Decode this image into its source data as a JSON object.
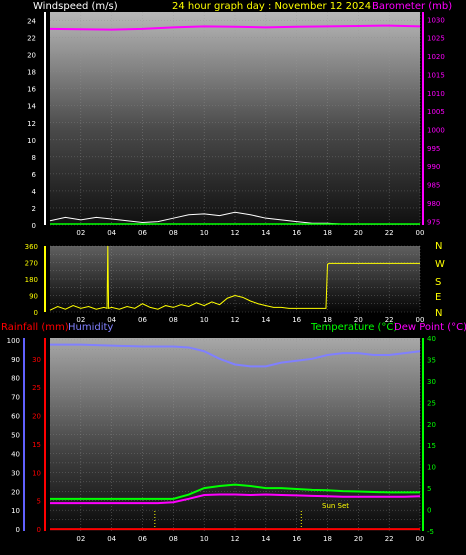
{
  "header": {
    "left_label": "Windspeed (m/s)",
    "title": "24 hour graph day : November 12 2024",
    "right_label": "Barometer (mb)"
  },
  "direction_labels": [
    "N",
    "W",
    "S",
    "E",
    "N"
  ],
  "lower_header": {
    "rain_label": "Rainfall (mm)",
    "hum_label": "Humidity",
    "temp_label": "Temperature (°C)",
    "dew_label": "Dew Point (°C)"
  },
  "sunset_label": "Sun Set",
  "colors": {
    "windspeed": "#ffffff",
    "gust": "#00ff00",
    "barometer": "#ff00ff",
    "direction": "#ffff00",
    "temperature": "#00ff00",
    "dewpoint": "#ff00ff",
    "humidity": "#8080ff",
    "rainfall": "#ff0000",
    "title": "#ffff00"
  },
  "chart_data": [
    {
      "type": "line",
      "x_ticks": [
        "02",
        "04",
        "06",
        "08",
        "10",
        "12",
        "14",
        "16",
        "18",
        "20",
        "22",
        "00"
      ],
      "left_axis": {
        "label": "Windspeed (m/s)",
        "ticks": [
          0,
          2,
          4,
          6,
          8,
          10,
          12,
          14,
          16,
          18,
          20,
          22,
          24
        ],
        "range": [
          0,
          25
        ]
      },
      "right_axis": {
        "label": "Barometer (mb)",
        "ticks": [
          975,
          980,
          985,
          990,
          995,
          1000,
          1005,
          1010,
          1015,
          1020,
          1025,
          1030
        ],
        "range": [
          974,
          1032
        ]
      },
      "series": [
        {
          "name": "Barometer (mb)",
          "x": [
            0,
            2,
            4,
            6,
            8,
            10,
            12,
            14,
            16,
            18,
            20,
            22,
            24
          ],
          "values": [
            1027.4,
            1027.3,
            1027.2,
            1027.4,
            1027.8,
            1028.1,
            1028.0,
            1027.8,
            1028.0,
            1028.1,
            1028.2,
            1028.3,
            1028.1
          ]
        },
        {
          "name": "Windspeed (m/s)",
          "x": [
            0,
            1,
            2,
            3,
            4,
            5,
            6,
            7,
            8,
            9,
            10,
            11,
            12,
            13,
            14,
            15,
            16,
            17,
            18,
            19,
            20,
            21,
            22,
            23,
            24
          ],
          "values": [
            0.5,
            0.9,
            0.6,
            0.9,
            0.7,
            0.5,
            0.3,
            0.4,
            0.8,
            1.2,
            1.3,
            1.1,
            1.5,
            1.2,
            0.8,
            0.6,
            0.4,
            0.2,
            0.2,
            0.1,
            0.1,
            0.1,
            0.1,
            0.1,
            0.1
          ]
        }
      ]
    },
    {
      "type": "line",
      "x_ticks": [
        "02",
        "04",
        "06",
        "08",
        "10",
        "12",
        "14",
        "16",
        "18",
        "20",
        "22",
        "00"
      ],
      "left_axis": {
        "ticks": [
          0,
          45,
          90,
          135,
          180,
          225,
          270,
          315,
          360
        ],
        "range": [
          0,
          360
        ]
      },
      "series": [
        {
          "name": "Wind direction",
          "x": [
            0,
            0.5,
            1,
            1.5,
            2,
            2.5,
            3,
            3.5,
            3.7,
            3.75,
            3.8,
            4,
            4.5,
            5,
            5.5,
            6,
            6.5,
            7,
            7.5,
            8,
            8.5,
            9,
            9.5,
            10,
            10.5,
            11,
            11.5,
            12,
            12.5,
            13,
            13.5,
            14,
            14.5,
            15,
            15.5,
            16,
            16.5,
            17,
            17.5,
            17.9,
            18,
            18.1,
            19,
            20,
            21,
            22,
            23,
            24
          ],
          "values": [
            10,
            30,
            15,
            35,
            20,
            30,
            15,
            25,
            20,
            360,
            20,
            25,
            15,
            30,
            20,
            45,
            25,
            15,
            35,
            25,
            40,
            30,
            50,
            35,
            55,
            40,
            75,
            90,
            80,
            60,
            45,
            35,
            25,
            25,
            20,
            20,
            20,
            20,
            20,
            20,
            260,
            265,
            265,
            265,
            265,
            265,
            265,
            265
          ]
        }
      ]
    },
    {
      "type": "line",
      "x_ticks": [
        "02",
        "04",
        "06",
        "08",
        "10",
        "12",
        "14",
        "16",
        "18",
        "20",
        "22",
        "00"
      ],
      "left_axis": {
        "label": "Rainfall (mm) / Humidity",
        "ticks": [
          0,
          5,
          10,
          15,
          20,
          25,
          30,
          35,
          40,
          45,
          50,
          55,
          60,
          65,
          70,
          75,
          80,
          85,
          90,
          95,
          100
        ],
        "range": [
          -1,
          101
        ]
      },
      "rainfall_ticks": [
        0,
        5,
        10,
        15,
        20,
        25,
        30
      ],
      "right_axis": {
        "label": "Temperature (°C)",
        "ticks": [
          -5,
          0,
          5,
          10,
          15,
          20,
          25,
          30,
          35,
          40
        ],
        "range": [
          -5,
          40
        ]
      },
      "series": [
        {
          "name": "Humidity",
          "x": [
            0,
            2,
            4,
            6,
            7,
            8,
            9,
            10,
            11,
            12,
            13,
            14,
            15,
            16,
            17,
            18,
            19,
            20,
            21,
            22,
            23,
            24
          ],
          "values": [
            97.5,
            97.5,
            97,
            96.5,
            96.5,
            96.5,
            96,
            94,
            90,
            87,
            86,
            86,
            88,
            89,
            90,
            92,
            93,
            93,
            92,
            92,
            93,
            94
          ]
        },
        {
          "name": "Temperature (°C)",
          "x": [
            0,
            2,
            4,
            6,
            7,
            8,
            9,
            10,
            11,
            12,
            13,
            14,
            15,
            16,
            17,
            18,
            19,
            20,
            21,
            22,
            23,
            24
          ],
          "values": [
            2.5,
            2.5,
            2.5,
            2.5,
            2.5,
            2.5,
            3.5,
            5,
            5.5,
            5.8,
            5.5,
            5,
            5,
            4.8,
            4.6,
            4.5,
            4.3,
            4.2,
            4.1,
            4,
            4,
            4
          ]
        },
        {
          "name": "Dew Point (°C)",
          "x": [
            0,
            2,
            4,
            6,
            7,
            8,
            9,
            10,
            11,
            12,
            13,
            14,
            15,
            16,
            17,
            18,
            19,
            20,
            21,
            22,
            23,
            24
          ],
          "values": [
            1.5,
            1.5,
            1.5,
            1.5,
            1.5,
            1.7,
            2.5,
            3.4,
            3.5,
            3.5,
            3.4,
            3.5,
            3.4,
            3.3,
            3.2,
            3.1,
            3,
            3,
            3,
            3,
            3,
            3.1
          ]
        },
        {
          "name": "Rainfall (mm)",
          "x": [
            0,
            24
          ],
          "values": [
            0,
            0
          ]
        }
      ],
      "annotations": [
        "Sun Set"
      ]
    }
  ]
}
